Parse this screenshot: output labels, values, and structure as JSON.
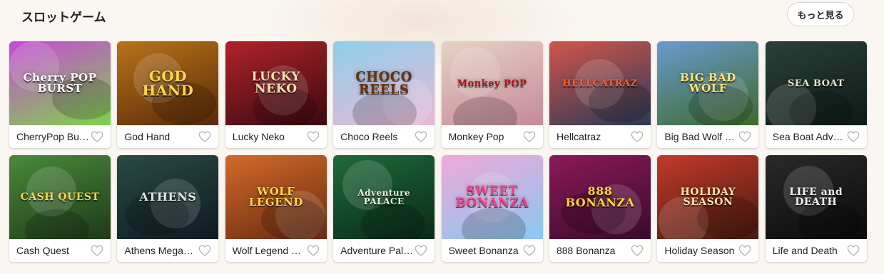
{
  "section": {
    "title": "スロットゲーム",
    "more_label": "もっと見る"
  },
  "games": [
    {
      "name": "CherryPop Bu…",
      "art_title": "Cherry POP BURST",
      "bg": "#c64ad6",
      "bg2": "#7fd24a",
      "fg": "#ffffff"
    },
    {
      "name": "God Hand",
      "art_title": "GOD HAND",
      "bg": "#b8741a",
      "bg2": "#5a2a08",
      "fg": "#ffd64a"
    },
    {
      "name": "Lucky Neko",
      "art_title": "LUCKY NEKO",
      "bg": "#b0232a",
      "bg2": "#3a0a10",
      "fg": "#f3e1b0"
    },
    {
      "name": "Choco Reels",
      "art_title": "CHOCO REELS",
      "bg": "#8ecfe8",
      "bg2": "#e8b8d8",
      "fg": "#6a3410"
    },
    {
      "name": "Monkey Pop",
      "art_title": "Monkey POP",
      "bg": "#e6d2c4",
      "bg2": "#c58a9a",
      "fg": "#b81818"
    },
    {
      "name": "Hellcatraz",
      "art_title": "HELLCATRAZ",
      "bg": "#d2554a",
      "bg2": "#2a3a58",
      "fg": "#ff5a2a"
    },
    {
      "name": "Big Bad Wolf …",
      "art_title": "BIG BAD WOLF",
      "bg": "#6a9ad0",
      "bg2": "#3c6a2a",
      "fg": "#ffe27a"
    },
    {
      "name": "Sea Boat Adv…",
      "art_title": "SEA BOAT",
      "bg": "#2a4038",
      "bg2": "#0e1a18",
      "fg": "#e8e2c8"
    },
    {
      "name": "Cash Quest",
      "art_title": "CASH QUEST",
      "bg": "#4a8a3a",
      "bg2": "#1e3a1a",
      "fg": "#ffd24a"
    },
    {
      "name": "Athens Mega…",
      "art_title": "ATHENS",
      "bg": "#2a4a44",
      "bg2": "#0e1a22",
      "fg": "#d8e8e0"
    },
    {
      "name": "Wolf Legend …",
      "art_title": "WOLF LEGEND",
      "bg": "#d26a2a",
      "bg2": "#6a2a10",
      "fg": "#ffd84a"
    },
    {
      "name": "Adventure Pal…",
      "art_title": "Adventure PALACE",
      "bg": "#1e6a3a",
      "bg2": "#0a2a18",
      "fg": "#e8f0d8"
    },
    {
      "name": "Sweet Bonanza",
      "art_title": "SWEET BONANZA",
      "bg": "#f0a8d8",
      "bg2": "#8ac8f0",
      "fg": "#ff3a8a"
    },
    {
      "name": "888 Bonanza",
      "art_title": "888 BONANZA",
      "bg": "#8a1a5a",
      "bg2": "#3a0a2a",
      "fg": "#ffd23a"
    },
    {
      "name": "Holiday Season",
      "art_title": "HOLIDAY SEASON",
      "bg": "#c23a2a",
      "bg2": "#4a1a10",
      "fg": "#ffe6a8"
    },
    {
      "name": "Life and Death",
      "art_title": "LIFE and DEATH",
      "bg": "#2a2a2a",
      "bg2": "#0a0a0a",
      "fg": "#f0f0f0"
    }
  ]
}
